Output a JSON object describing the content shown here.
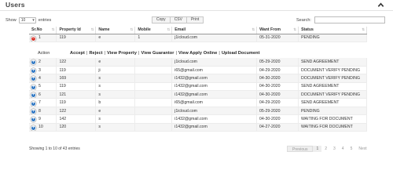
{
  "header": {
    "title": "Users"
  },
  "controls": {
    "show_label": "Show",
    "entries_value": "10",
    "entries_label": "entries",
    "buttons": [
      "Copy",
      "CSV",
      "Print"
    ],
    "search_label": "Search:",
    "search_value": ""
  },
  "table": {
    "columns": [
      "Sr.No",
      "Property Id",
      "Name",
      "Mobile",
      "Email",
      "Want From",
      "Status"
    ],
    "expanded_row": {
      "sn": "1",
      "property_id": "119",
      "name": "e",
      "mobile": "1",
      "email": "j1icloud.com",
      "want_from": "05-31-2020",
      "status": "PENDING"
    },
    "action": {
      "label": "Action",
      "links": [
        "Accept",
        "Reject",
        "View Property",
        "View Guarantor",
        "View Apply Online",
        "Upload Document"
      ]
    },
    "rows": [
      {
        "sn": "2",
        "property_id": "122",
        "name": "e",
        "mobile": "",
        "email": "j1icloud.com",
        "want_from": "05-29-2020",
        "status": "SEND AGREEMENT"
      },
      {
        "sn": "3",
        "property_id": "119",
        "name": "ji",
        "mobile": "",
        "email": "i65@gmail.com",
        "want_from": "04-29-2020",
        "status": "DOCUMENT VERIFY PENDING"
      },
      {
        "sn": "4",
        "property_id": "169",
        "name": "s",
        "mobile": "",
        "email": "i1432@gmail.com",
        "want_from": "04-30-2020",
        "status": "DOCUMENT VERIFY PENDING"
      },
      {
        "sn": "5",
        "property_id": "119",
        "name": "s",
        "mobile": "",
        "email": "i1432@gmail.com",
        "want_from": "04-30-2020",
        "status": "SEND AGREEMENT"
      },
      {
        "sn": "6",
        "property_id": "121",
        "name": "s",
        "mobile": "",
        "email": "i1432@gmail.com",
        "want_from": "04-30-2020",
        "status": "DOCUMENT VERIFY PENDING"
      },
      {
        "sn": "7",
        "property_id": "119",
        "name": "b",
        "mobile": "",
        "email": "i65@gmail.com",
        "want_from": "04-29-2020",
        "status": "SEND AGREEMENT"
      },
      {
        "sn": "8",
        "property_id": "122",
        "name": "e",
        "mobile": "",
        "email": "j1icloud.com",
        "want_from": "05-29-2020",
        "status": "PENDING"
      },
      {
        "sn": "9",
        "property_id": "142",
        "name": "s",
        "mobile": "",
        "email": "i1432@gmail.com",
        "want_from": "04-30-2020",
        "status": "WAITING FOR DOCUMENT"
      },
      {
        "sn": "10",
        "property_id": "120",
        "name": "s",
        "mobile": "",
        "email": "i1432@gmail.com",
        "want_from": "04-27-2020",
        "status": "WAITING FOR DOCUMENT"
      }
    ]
  },
  "footer": {
    "info": "Showing 1 to 10 of 43 entries",
    "pagination": {
      "prev": "Previous",
      "pages": [
        "1",
        "2",
        "3",
        "4",
        "5"
      ],
      "current": "1",
      "next": "Next"
    }
  }
}
